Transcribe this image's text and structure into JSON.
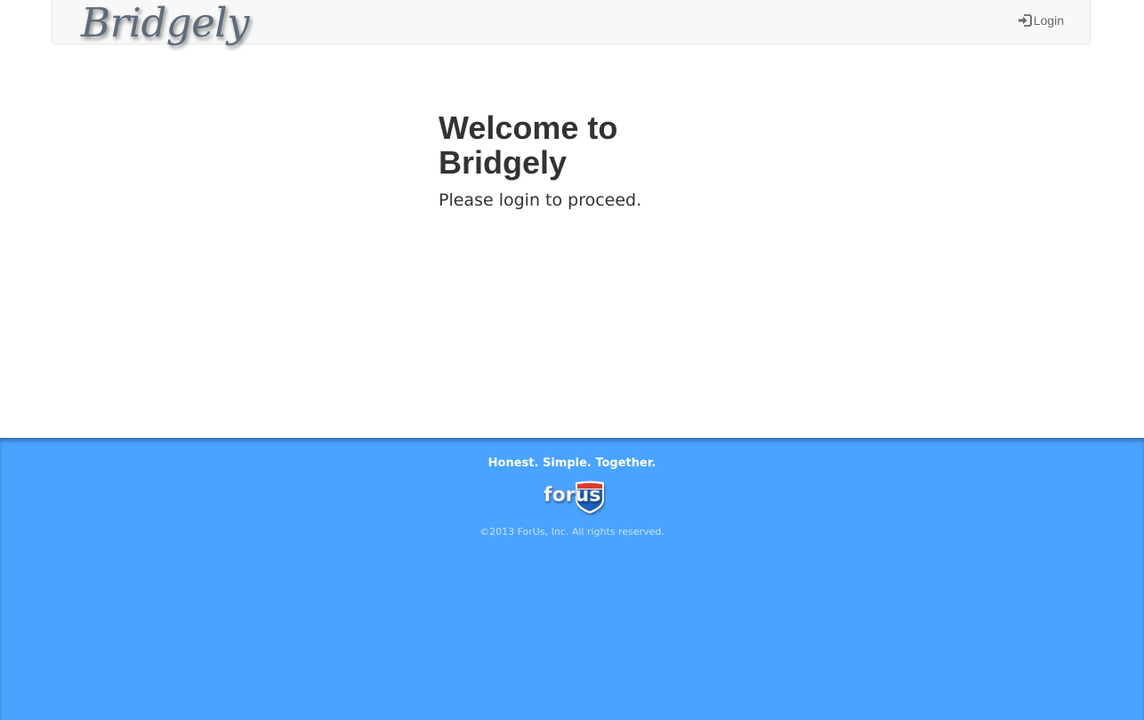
{
  "navbar": {
    "brand": "Bridgely",
    "login_label": "Login",
    "login_icon": "sign-in-icon"
  },
  "main": {
    "title_line1": "Welcome to",
    "title_line2": "Bridgely",
    "subtitle": "Please login to proceed."
  },
  "footer": {
    "tagline": "Honest. Simple. Together.",
    "logo_text": "forus",
    "copyright": "©2013 ForUs, Inc. All rights reserved."
  },
  "colors": {
    "footer_background": "#4aa3ff",
    "navbar_background": "#f8f8f8",
    "text_dark": "#333333",
    "logo_red": "#e03a2f",
    "logo_blue": "#1f5fbf"
  }
}
